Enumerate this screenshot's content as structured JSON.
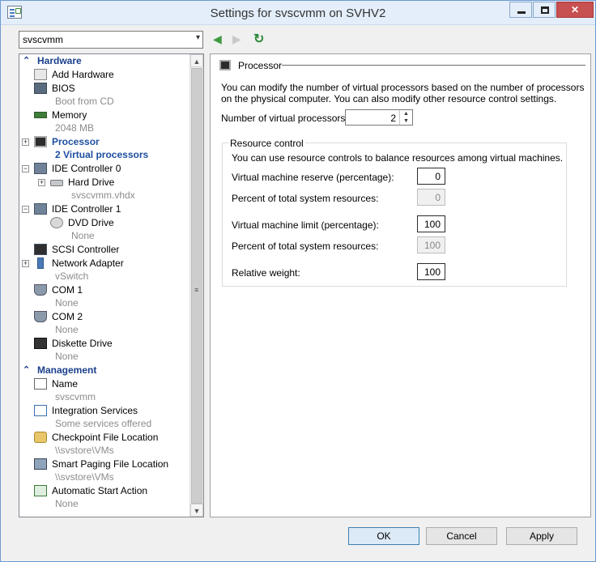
{
  "window": {
    "title": "Settings for svscvmm on SVHV2",
    "close_glyph": "✕"
  },
  "vm_select": {
    "value": "svscvmm",
    "arrow": "▾"
  },
  "nav": {
    "back": "◀",
    "forward": "▶",
    "refresh": "↻"
  },
  "tree": {
    "hardware_header": "Hardware",
    "management_header": "Management",
    "items": [
      {
        "label": "Add Hardware",
        "sub": ""
      },
      {
        "label": "BIOS",
        "sub": "Boot from CD"
      },
      {
        "label": "Memory",
        "sub": "2048 MB"
      },
      {
        "label": "Processor",
        "sub": "2 Virtual processors"
      },
      {
        "label": "IDE Controller 0",
        "sub": ""
      },
      {
        "label": "Hard Drive",
        "sub": "svscvmm.vhdx"
      },
      {
        "label": "IDE Controller 1",
        "sub": ""
      },
      {
        "label": "DVD Drive",
        "sub": "None"
      },
      {
        "label": "SCSI Controller",
        "sub": ""
      },
      {
        "label": "Network Adapter",
        "sub": "vSwitch"
      },
      {
        "label": "COM 1",
        "sub": "None"
      },
      {
        "label": "COM 2",
        "sub": "None"
      },
      {
        "label": "Diskette Drive",
        "sub": "None"
      }
    ],
    "mgmt_items": [
      {
        "label": "Name",
        "sub": "svscvmm"
      },
      {
        "label": "Integration Services",
        "sub": "Some services offered"
      },
      {
        "label": "Checkpoint File Location",
        "sub": "\\\\svstore\\VMs"
      },
      {
        "label": "Smart Paging File Location",
        "sub": "\\\\svstore\\VMs"
      },
      {
        "label": "Automatic Start Action",
        "sub": "None"
      }
    ]
  },
  "panel": {
    "heading": "Processor",
    "description": "You can modify the number of virtual processors based on the number of processors on the physical computer. You can also modify other resource control settings.",
    "vproc_label": "Number of virtual processors:",
    "vproc_value": "2",
    "group_title": "Resource control",
    "group_desc": "You can use resource controls to balance resources among virtual machines.",
    "reserve_label": "Virtual machine reserve (percentage):",
    "reserve_value": "0",
    "reserve_pct_label": "Percent of total system resources:",
    "reserve_pct_value": "0",
    "limit_label": "Virtual machine limit (percentage):",
    "limit_value": "100",
    "limit_pct_label": "Percent of total system resources:",
    "limit_pct_value": "100",
    "weight_label": "Relative weight:",
    "weight_value": "100"
  },
  "buttons": {
    "ok": "OK",
    "cancel": "Cancel",
    "apply": "Apply"
  }
}
